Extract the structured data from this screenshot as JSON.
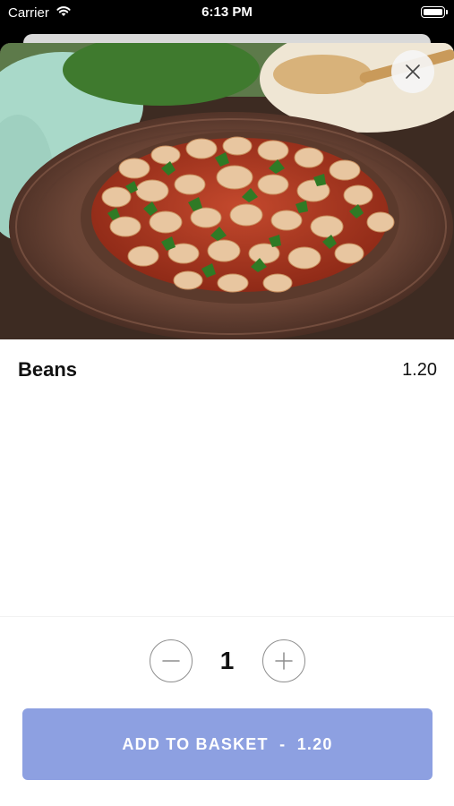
{
  "status_bar": {
    "carrier": "Carrier",
    "time": "6:13 PM",
    "icons": [
      "wifi-icon",
      "battery-icon"
    ]
  },
  "product": {
    "name": "Beans",
    "price": "1.20",
    "image": "bowl of baked beans in tomato sauce with parsley"
  },
  "stepper": {
    "quantity": "1",
    "decrement_icon": "minus-icon",
    "increment_icon": "plus-icon"
  },
  "add_button": {
    "label": "ADD TO BASKET",
    "separator": "-",
    "price": "1.20"
  },
  "close_icon": "close-icon",
  "colors": {
    "button_bg": "#8da0e1",
    "button_text": "#ffffff",
    "stepper_border": "#8e8e8e"
  }
}
